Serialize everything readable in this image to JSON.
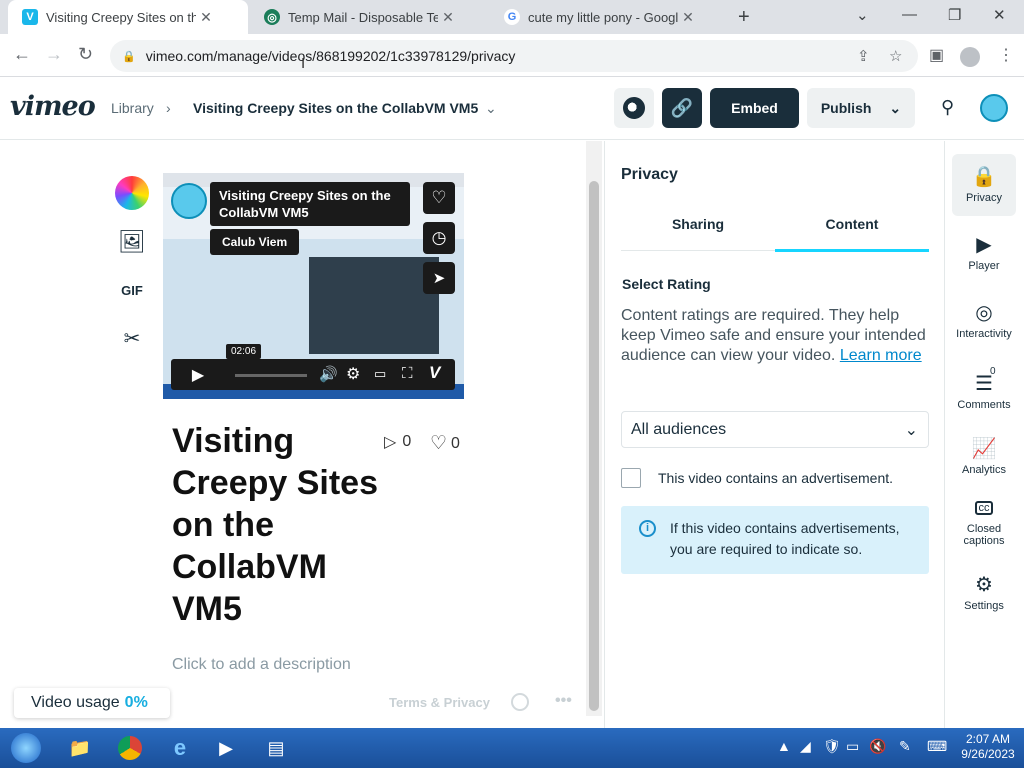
{
  "browser": {
    "tabs": [
      {
        "title": "Visiting Creepy Sites on the Colla",
        "active": true,
        "favicon": "vimeo-icon"
      },
      {
        "title": "Temp Mail - Disposable Tempora",
        "active": false,
        "favicon": "tempmail-icon"
      },
      {
        "title": "cute my little pony - Google Sea",
        "active": false,
        "favicon": "google-icon"
      }
    ],
    "url": "vimeo.com/manage/videos/868199202/1c33978129/privacy"
  },
  "header": {
    "logo": "vimeo",
    "breadcrumb_library": "Library",
    "breadcrumb_title": "Visiting Creepy Sites on the CollabVM VM5",
    "embed_label": "Embed",
    "publish_label": "Publish"
  },
  "player": {
    "title": "Visiting Creepy Sites on the CollabVM VM5",
    "channel": "Calub Viem",
    "timestamp": "02:06"
  },
  "tools": {
    "gif_label": "GIF"
  },
  "video_info": {
    "title": "Visiting Creepy Sites on the CollabVM VM5",
    "plays": "0",
    "likes": "0",
    "description_placeholder": "Click to add a description"
  },
  "usage": {
    "label": "Video usage",
    "value": "0%"
  },
  "footer": {
    "terms": "Terms & Privacy"
  },
  "privacy": {
    "title": "Privacy",
    "tabs": [
      {
        "label": "Sharing",
        "active": false
      },
      {
        "label": "Content",
        "active": true
      }
    ],
    "rating_label": "Select Rating",
    "rating_text": "Content ratings are required. They help keep Vimeo safe and ensure your intended audience can view your video.",
    "learn_more": "Learn more",
    "rating_value": "All audiences",
    "ad_checkbox_label": "This video contains an advertisement.",
    "ad_notice": "If this video contains advertisements, you are required to indicate so."
  },
  "rail": [
    {
      "label": "Privacy",
      "icon": "lock-icon",
      "active": true
    },
    {
      "label": "Player",
      "icon": "player-icon",
      "active": false
    },
    {
      "label": "Interactivity",
      "icon": "interactivity-icon",
      "active": false
    },
    {
      "label": "Comments",
      "icon": "comments-icon",
      "active": false,
      "badge": "0"
    },
    {
      "label": "Analytics",
      "icon": "analytics-icon",
      "active": false
    },
    {
      "label": "Closed captions",
      "icon": "cc-icon",
      "active": false
    },
    {
      "label": "Settings",
      "icon": "gear-icon",
      "active": false
    }
  ],
  "taskbar": {
    "time": "2:07 AM",
    "date": "9/26/2023"
  },
  "colors": {
    "accent": "#17d5ff",
    "dark_button": "#1a2e3b",
    "link": "#0088cc"
  }
}
